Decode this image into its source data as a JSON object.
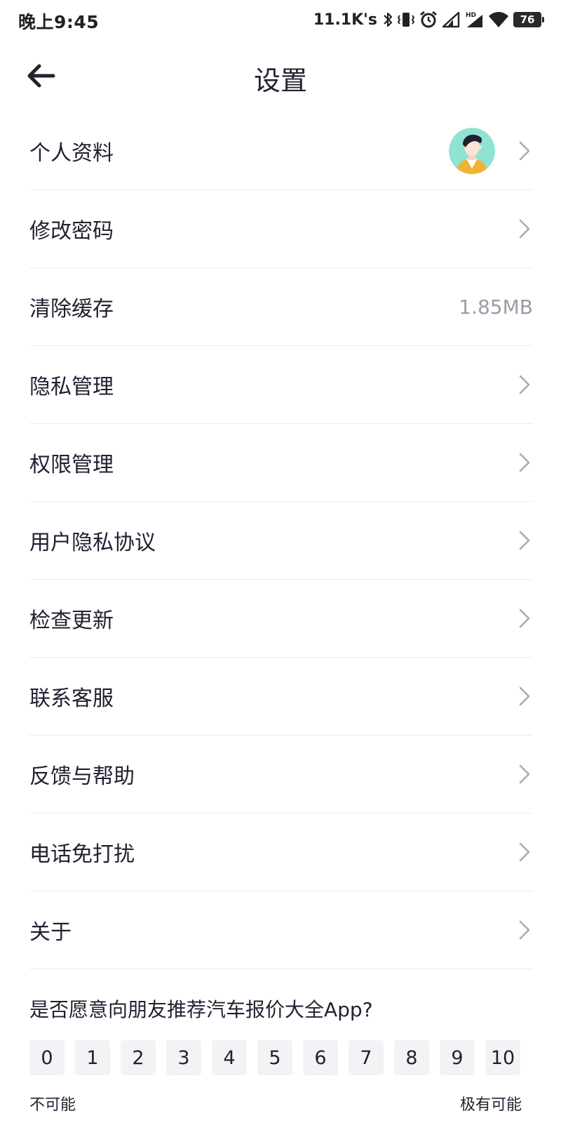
{
  "status_bar": {
    "time": "晚上9:45",
    "net_speed": "11.1K's",
    "battery": "76",
    "icons": [
      "bluetooth-icon",
      "vibrate-icon",
      "alarm-icon",
      "signal-icon",
      "signal-hd-icon",
      "wifi-icon",
      "battery-icon"
    ]
  },
  "header": {
    "back_icon": "arrow-left-icon",
    "title": "设置"
  },
  "settings": {
    "items": [
      {
        "label": "个人资料",
        "trailing": "avatar"
      },
      {
        "label": "修改密码",
        "trailing": "chevron"
      },
      {
        "label": "清除缓存",
        "trailing": "value",
        "value": "1.85MB"
      },
      {
        "label": "隐私管理",
        "trailing": "chevron"
      },
      {
        "label": "权限管理",
        "trailing": "chevron"
      },
      {
        "label": "用户隐私协议",
        "trailing": "chevron"
      },
      {
        "label": "检查更新",
        "trailing": "chevron"
      },
      {
        "label": "联系客服",
        "trailing": "chevron"
      },
      {
        "label": "反馈与帮助",
        "trailing": "chevron"
      },
      {
        "label": "电话免打扰",
        "trailing": "chevron"
      },
      {
        "label": "关于",
        "trailing": "chevron"
      }
    ]
  },
  "survey": {
    "question": "是否愿意向朋友推荐汽车报价大全App?",
    "scores": [
      "0",
      "1",
      "2",
      "3",
      "4",
      "5",
      "6",
      "7",
      "8",
      "9",
      "10"
    ],
    "low_label": "不可能",
    "high_label": "极有可能"
  },
  "colors": {
    "text": "#1f2130",
    "secondary_text": "#9a9ca6",
    "divider": "#ececef",
    "score_bg": "#f3f3f6",
    "avatar_bg": "#8fe3d2"
  }
}
